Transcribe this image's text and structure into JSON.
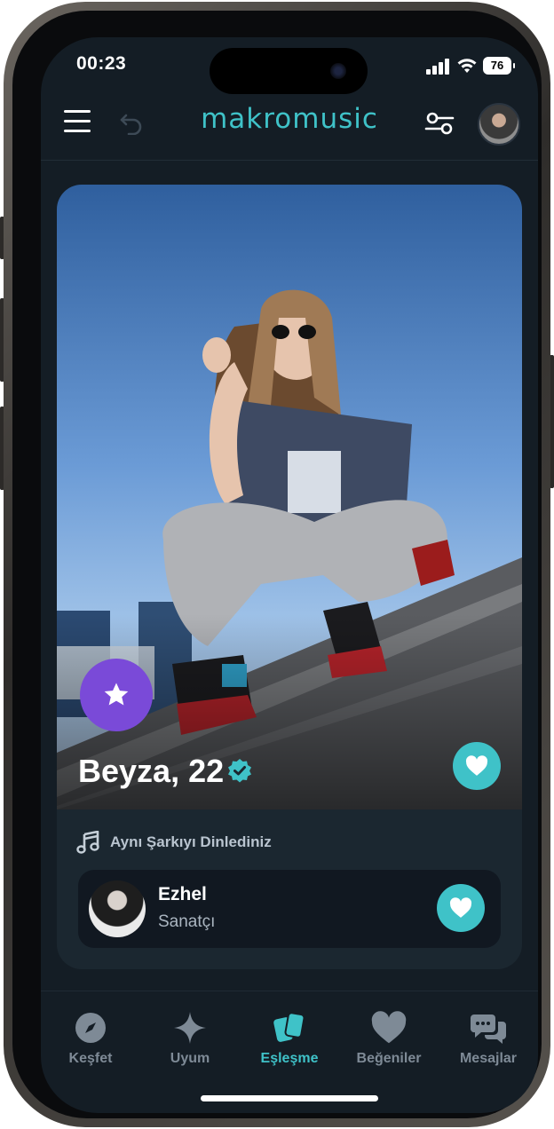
{
  "status": {
    "time": "00:23",
    "battery": "76"
  },
  "header": {
    "logo": "makromusic"
  },
  "profile": {
    "name_age": "Beyza, 22"
  },
  "match_info": {
    "label": "Aynı Şarkıyı Dinlediniz"
  },
  "artist": {
    "name": "Ezhel",
    "role": "Sanatçı"
  },
  "tabs": [
    {
      "label": "Keşfet",
      "icon": "compass-icon"
    },
    {
      "label": "Uyum",
      "icon": "sparkle-icon"
    },
    {
      "label": "Eşleşme",
      "icon": "cards-icon"
    },
    {
      "label": "Beğeniler",
      "icon": "heart-icon"
    },
    {
      "label": "Mesajlar",
      "icon": "chat-icon"
    }
  ],
  "colors": {
    "accent": "#3fc2c8",
    "background": "#141d25",
    "favorite": "#7a4ad8"
  }
}
